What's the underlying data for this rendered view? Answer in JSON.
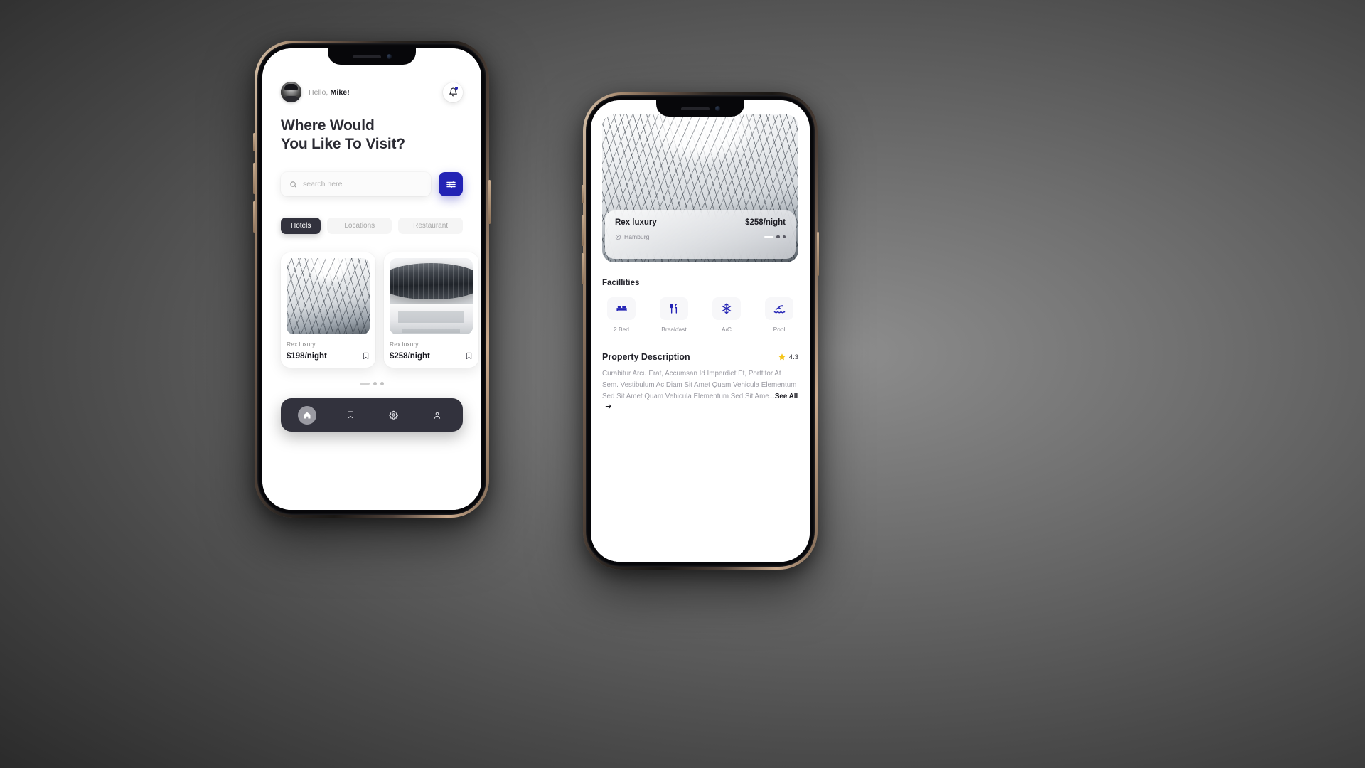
{
  "phone1": {
    "greeting": {
      "hello": "Hello,",
      "name": "Mike!"
    },
    "notification_icon": "bell-icon",
    "headline_line1": "Where Would",
    "headline_line2": "You Like To Visit?",
    "search": {
      "placeholder": "search here",
      "value": "",
      "icon": "search-icon"
    },
    "filter_button": {
      "icon": "sliders-icon",
      "color": "#2323b5"
    },
    "tabs": [
      {
        "label": "Hotels",
        "active": true
      },
      {
        "label": "Locations",
        "active": false
      },
      {
        "label": "Restaurant",
        "active": false
      }
    ],
    "cards": [
      {
        "name": "Rex luxury",
        "price": "$198/night",
        "bookmark_icon": "bookmark-icon",
        "art": "glassbldg"
      },
      {
        "name": "Rex luxury",
        "price": "$258/night",
        "bookmark_icon": "bookmark-icon",
        "art": "museum"
      }
    ],
    "navbar": [
      {
        "icon": "home-icon",
        "active": true
      },
      {
        "icon": "bookmark-icon",
        "active": false
      },
      {
        "icon": "gear-icon",
        "active": false
      },
      {
        "icon": "person-icon",
        "active": false
      }
    ]
  },
  "phone2": {
    "hero": {
      "art": "glassbldg",
      "name": "Rex luxury",
      "price": "$258/night",
      "location": "Hamburg",
      "location_icon": "map-pin-icon"
    },
    "facilities_title": "Facillities",
    "facilities": [
      {
        "label": "2 Bed",
        "icon": "bed-icon"
      },
      {
        "label": "Breakfast",
        "icon": "cutlery-icon"
      },
      {
        "label": "A/C",
        "icon": "snowflake-icon"
      },
      {
        "label": "Pool",
        "icon": "pool-icon"
      }
    ],
    "description_title": "Property Description",
    "rating": {
      "value": "4.3",
      "icon": "star-icon",
      "color": "#f6c game"
    },
    "description_text": "Curabitur Arcu Erat, Accumsan Id Imperdiet Et, Porttitor At Sem. Vestibulum Ac Diam Sit Amet Quam Vehicula Elementum Sed Sit Amet Quam Vehicula Elementum Sed Sit Ame...",
    "see_all_label": "See All",
    "see_all_icon": "arrow-right-icon"
  }
}
